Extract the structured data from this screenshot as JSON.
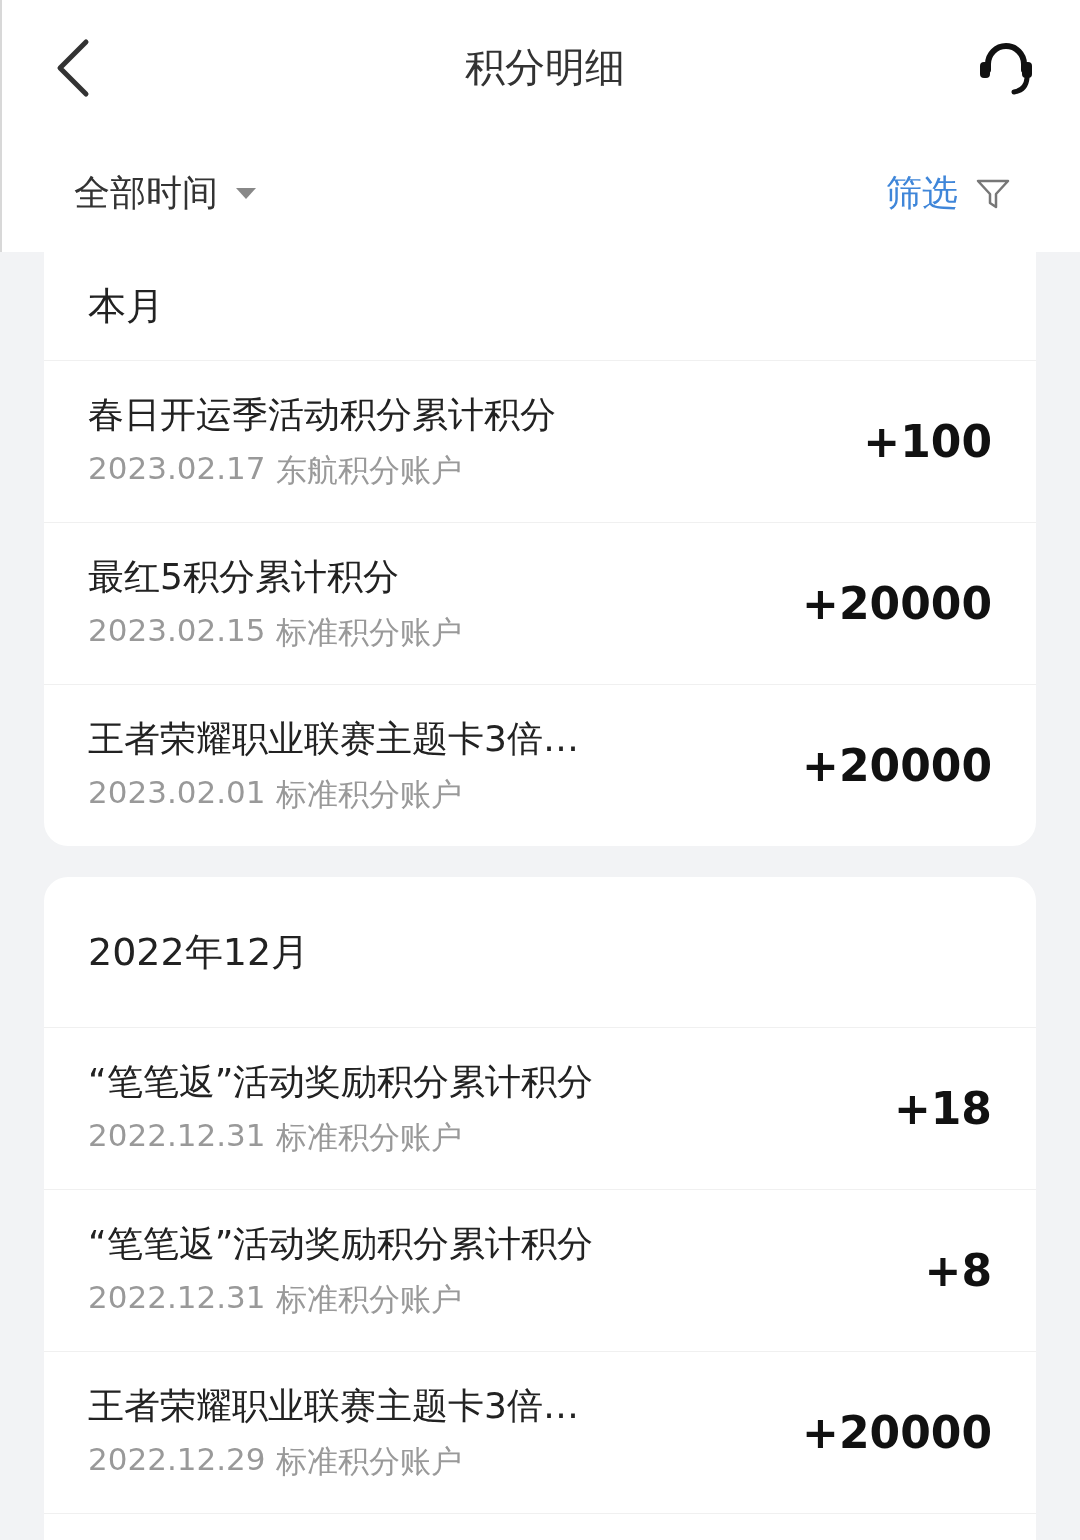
{
  "header": {
    "title": "积分明细"
  },
  "filter_bar": {
    "time_range": "全部时间",
    "filter": "筛选"
  },
  "sections": [
    {
      "month": "本月",
      "items": [
        {
          "title": "春日开运季活动积分累计积分",
          "date": "2023.02.17",
          "account": "东航积分账户",
          "amount": "+100"
        },
        {
          "title": "最红5积分累计积分",
          "date": "2023.02.15",
          "account": "标准积分账户",
          "amount": "+20000"
        },
        {
          "title": "王者荣耀职业联赛主题卡3倍…",
          "date": "2023.02.01",
          "account": "标准积分账户",
          "amount": "+20000"
        }
      ]
    },
    {
      "month": "2022年12月",
      "items": [
        {
          "title": "“笔笔返”活动奖励积分累计积分",
          "date": "2022.12.31",
          "account": "标准积分账户",
          "amount": "+18"
        },
        {
          "title": "“笔笔返”活动奖励积分累计积分",
          "date": "2022.12.31",
          "account": "标准积分账户",
          "amount": "+8"
        },
        {
          "title": "王者荣耀职业联赛主题卡3倍…",
          "date": "2022.12.29",
          "account": "标准积分账户",
          "amount": "+20000"
        }
      ]
    }
  ]
}
